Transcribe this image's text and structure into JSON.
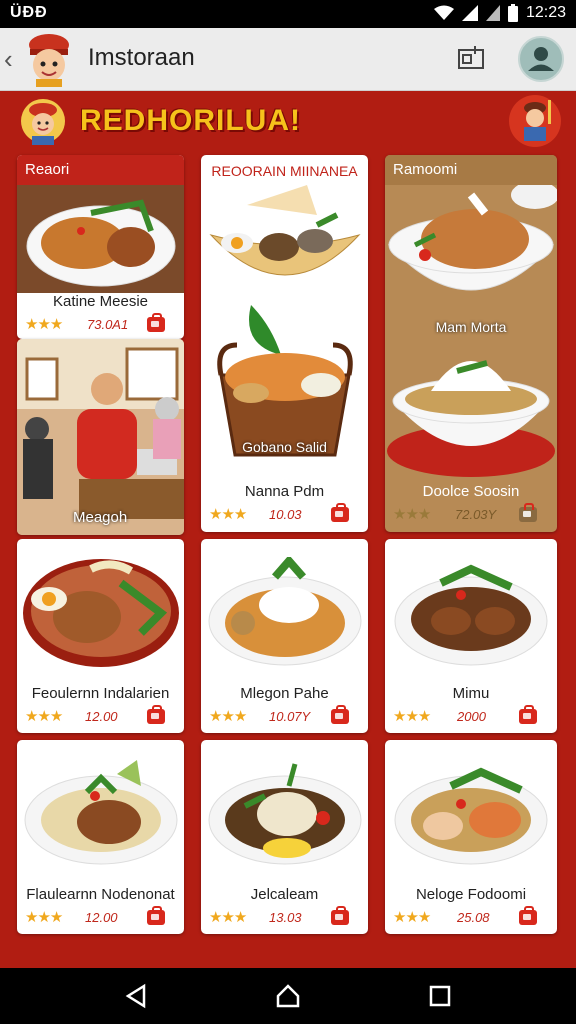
{
  "status_bar": {
    "left_text": "ÜÐÐ",
    "time": "12:23"
  },
  "app_bar": {
    "title": "Imstoraan"
  },
  "banner": {
    "title": "REDHORILUA!"
  },
  "cards": [
    {
      "header": "Reaori",
      "name": "Katine Meesie",
      "rating": "★★★",
      "price": "73.0A1"
    },
    {
      "name": "Meagoh"
    },
    {
      "header": "REOORAIN MIINANEA",
      "overlay": "Gobano Salid",
      "name": "Nanna Pdm",
      "rating": "★★★",
      "price": "10.03"
    },
    {
      "header": "Ramoomi",
      "overlay": "Mam Morta",
      "name": "Doolce Soosin",
      "rating": "★★★",
      "price": "72.03Y"
    },
    {
      "name": "Feoulernn Indalarien",
      "rating": "★★★",
      "price": "12.00"
    },
    {
      "name": "Mlegon Pahe",
      "rating": "★★★",
      "price": "10.07Y"
    },
    {
      "name": "Mimu",
      "rating": "★★★",
      "price": "2000"
    },
    {
      "name": "Flaulearnn Nodenonat",
      "rating": "★★★",
      "price": "12.00"
    },
    {
      "name": "Jelcaleam",
      "rating": "★★★",
      "price": "13.03"
    },
    {
      "name": "Neloge Fodoomi",
      "rating": "★★★",
      "price": "25.08"
    }
  ],
  "icons": [
    "back-arrow-icon",
    "store-icon",
    "user-icon",
    "cart-icon",
    "wifi-icon",
    "signal-icon",
    "battery-icon",
    "nav-back-icon",
    "nav-home-icon",
    "nav-recents-icon"
  ],
  "colors": {
    "accent": "#b11d12",
    "banner_text": "#f6c21b",
    "price": "#c0281c",
    "star": "#f0a81e"
  }
}
